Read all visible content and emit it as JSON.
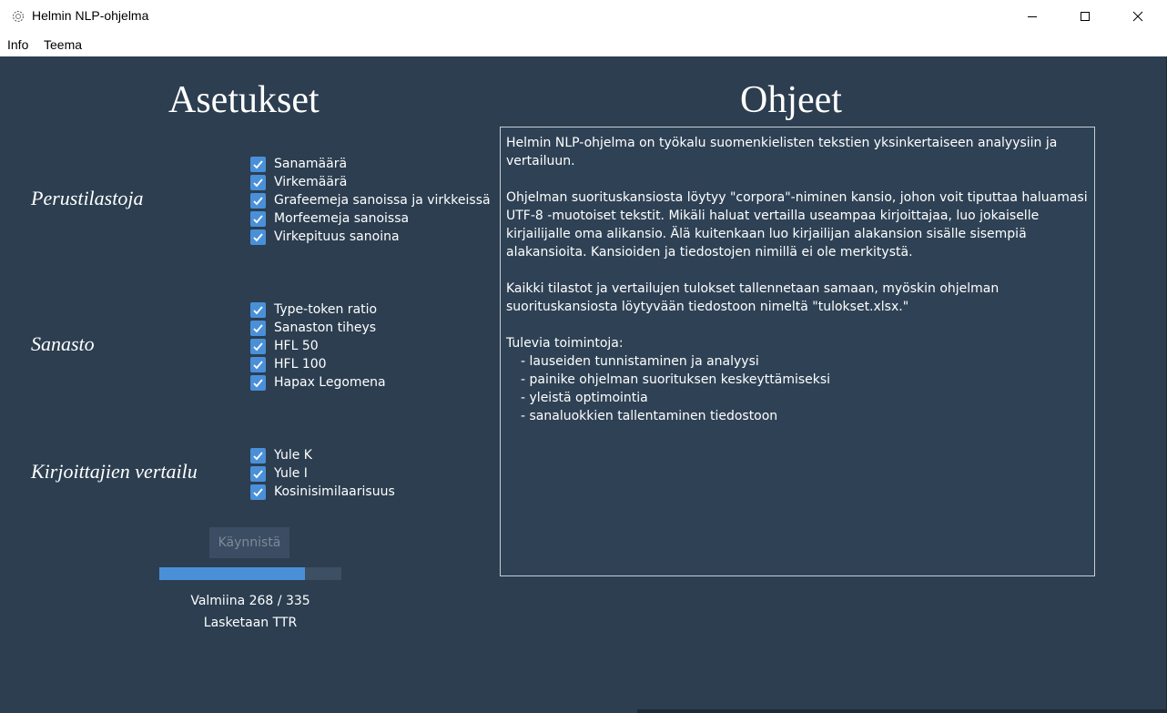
{
  "window": {
    "title": "Helmin NLP-ohjelma",
    "icon": "gear-flower-icon"
  },
  "menu": {
    "items": [
      "Info",
      "Teema"
    ]
  },
  "settings": {
    "heading": "Asetukset",
    "sections": [
      {
        "label": "Perustilastoja",
        "options": [
          {
            "label": "Sanamäärä",
            "checked": true
          },
          {
            "label": "Virkemäärä",
            "checked": true
          },
          {
            "label": "Grafeemeja sanoissa ja virkkeissä",
            "checked": true
          },
          {
            "label": "Morfeemeja sanoissa",
            "checked": true
          },
          {
            "label": "Virkepituus sanoina",
            "checked": true
          }
        ]
      },
      {
        "label": "Sanasto",
        "options": [
          {
            "label": "Type-token ratio",
            "checked": true
          },
          {
            "label": "Sanaston tiheys",
            "checked": true
          },
          {
            "label": "HFL 50",
            "checked": true
          },
          {
            "label": "HFL 100",
            "checked": true
          },
          {
            "label": "Hapax Legomena",
            "checked": true
          }
        ]
      },
      {
        "label": "Kirjoittajien vertailu",
        "options": [
          {
            "label": "Yule K",
            "checked": true
          },
          {
            "label": "Yule I",
            "checked": true
          },
          {
            "label": "Kosinisimilaarisuus",
            "checked": true
          }
        ]
      }
    ],
    "start_label": "Käynnistä",
    "progress": 0.8,
    "status_done": "Valmiina 268 / 335",
    "status_task": "Lasketaan TTR"
  },
  "help": {
    "heading": "Ohjeet",
    "paragraphs": [
      "Helmin NLP-ohjelma on työkalu suomenkielisten tekstien yksinkertaiseen analyysiin ja vertailuun.",
      "Ohjelman suorituskansiosta löytyy \"corpora\"-niminen kansio, johon voit tiputtaa haluamasi UTF-8 -muotoiset tekstit. Mikäli haluat vertailla useampaa kirjoittajaa, luo jokaiselle kirjailijalle oma alikansio. Älä kuitenkaan luo kirjailijan alakansion sisälle sisempiä alakansioita. Kansioiden ja tiedostojen nimillä ei ole merkitystä.",
      "Kaikki tilastot ja vertailujen tulokset tallennetaan samaan, myöskin ohjelman suorituskansiosta löytyvään tiedostoon nimeltä \"tulokset.xlsx.\""
    ],
    "upcoming_title": "Tulevia toimintoja:",
    "upcoming": [
      "lauseiden tunnistaminen ja analyysi",
      "painike ohjelman suorituksen keskeyttämiseksi",
      "yleistä optimointia",
      "sanaluokkien tallentaminen tiedostoon"
    ]
  },
  "colors": {
    "background": "#2c3e50",
    "accent": "#4a90d9",
    "text": "#ffffff"
  }
}
